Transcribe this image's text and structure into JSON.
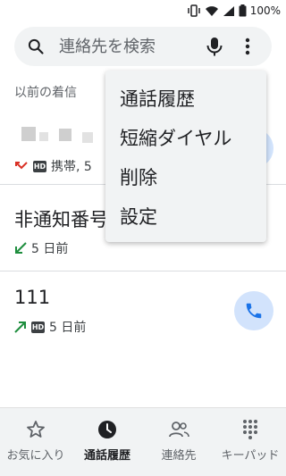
{
  "status_bar": {
    "battery": "100%",
    "icons": [
      "vibrate-icon",
      "wifi-icon",
      "signal-icon",
      "battery-icon"
    ]
  },
  "search": {
    "placeholder": "連絡先を検索",
    "icons": [
      "search-icon",
      "mic-icon",
      "more-vert-icon"
    ]
  },
  "section_header": "以前の着信",
  "calls": [
    {
      "name": "",
      "type_icon": "missed-call-icon",
      "badge": "HD",
      "detail": "携帯, 5"
    },
    {
      "name": "非通知番号",
      "type_icon": "incoming-call-icon",
      "detail": "5 日前"
    },
    {
      "name": "111",
      "type_icon": "outgoing-call-icon",
      "badge": "HD",
      "detail": "5 日前",
      "action_icon": "phone-icon"
    }
  ],
  "menu": {
    "items": [
      "通話履歴",
      "短縮ダイヤル",
      "削除",
      "設定"
    ]
  },
  "bottom_nav": {
    "items": [
      {
        "label": "お気に入り",
        "icon": "star-icon"
      },
      {
        "label": "通話履歴",
        "icon": "clock-icon",
        "active": true
      },
      {
        "label": "連絡先",
        "icon": "contacts-icon"
      },
      {
        "label": "キーパッド",
        "icon": "dialpad-icon"
      }
    ]
  },
  "colors": {
    "accent": "#1a73e8",
    "call_button_bg": "#d2e3fc",
    "missed": "#d93025",
    "incoming_outgoing": "#1e8e3e",
    "menu_bg": "#f1f3f4"
  }
}
